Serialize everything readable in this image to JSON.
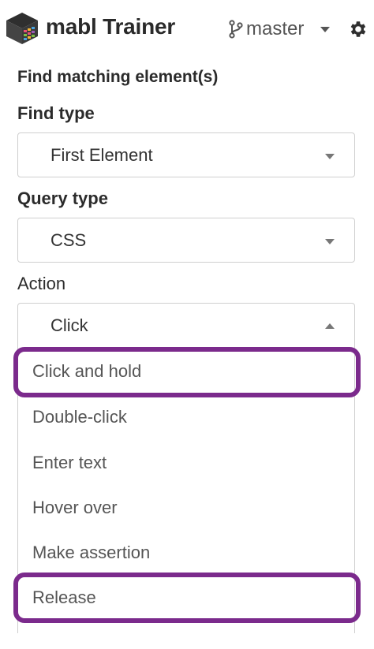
{
  "header": {
    "title": "mabl Trainer",
    "branch": "master",
    "logo_icon": "mabl-cube-logo",
    "branch_icon": "git-branch-icon",
    "settings_icon": "gear-icon"
  },
  "form": {
    "heading": "Find matching element(s)",
    "find_type": {
      "label": "Find type",
      "value": "First Element"
    },
    "query_type": {
      "label": "Query type",
      "value": "CSS"
    },
    "action": {
      "label": "Action",
      "value": "Click",
      "open": true,
      "options": [
        "Click and hold",
        "Double-click",
        "Enter text",
        "Hover over",
        "Make assertion",
        "Release"
      ],
      "highlighted_options": [
        "Click and hold",
        "Release"
      ]
    }
  },
  "colors": {
    "highlight": "#7b2a8c",
    "border": "#cfcfcf",
    "text": "#2b2b2b",
    "option_text": "#555555"
  }
}
